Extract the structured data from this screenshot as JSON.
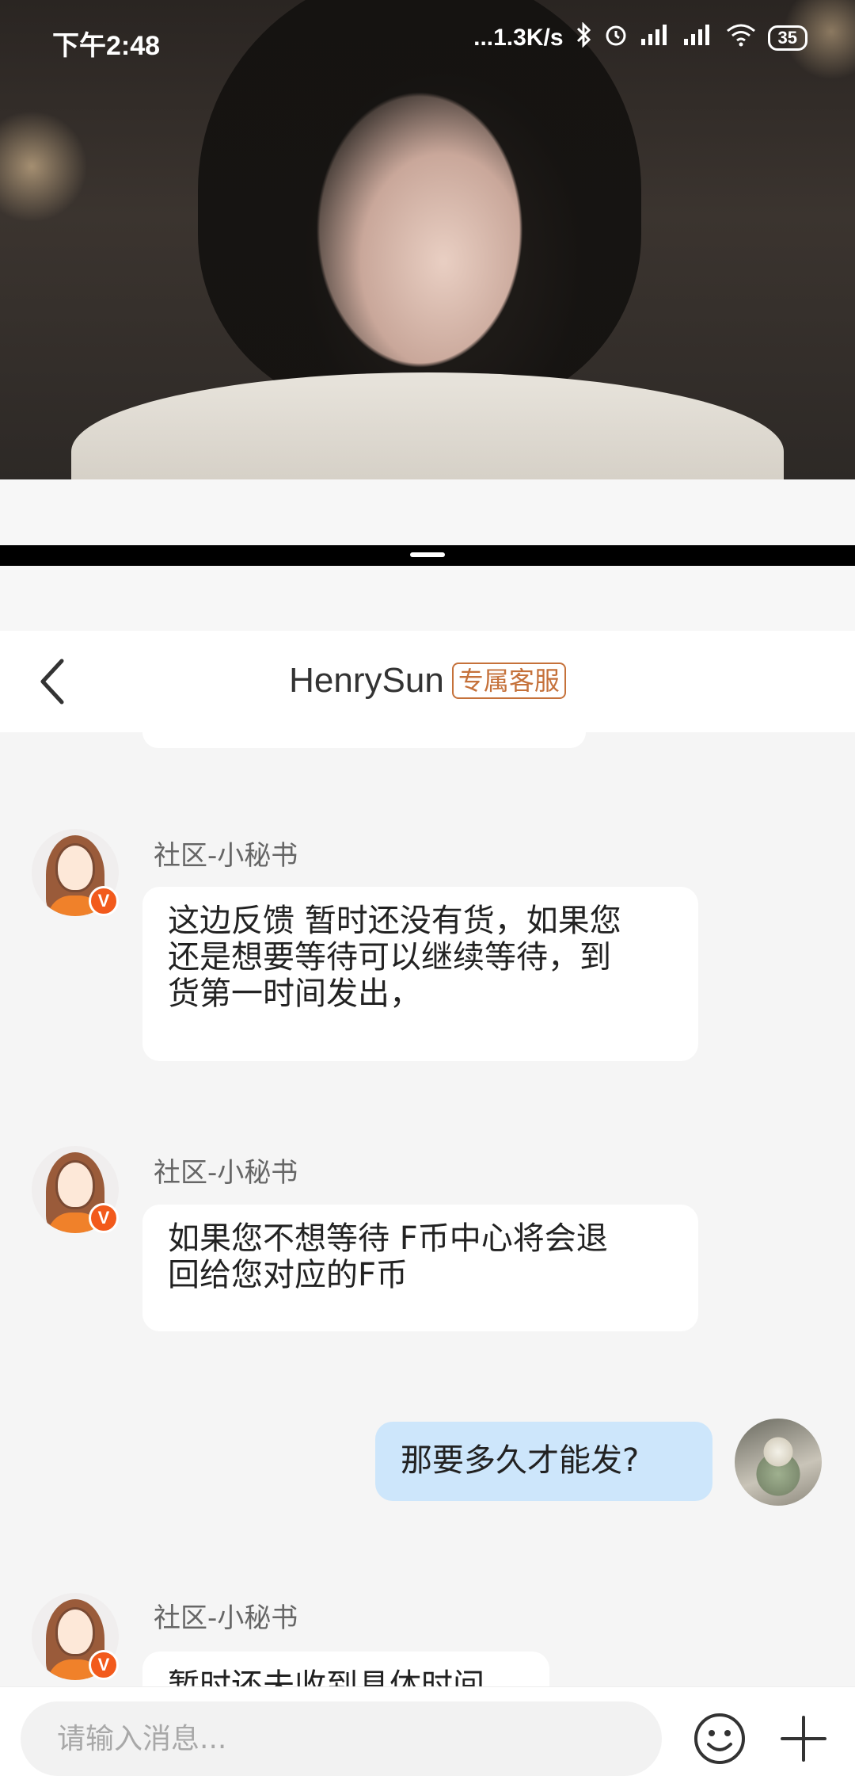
{
  "status_bar": {
    "time": "下午2:48",
    "network_speed": "...1.3K/s",
    "battery": "35"
  },
  "header": {
    "title": "HenrySun",
    "tag": "专属客服"
  },
  "messages": [
    {
      "sender": "社区-小秘书",
      "side": "left",
      "text_lines": [
        "这边反馈 暂时还没有货，如果您",
        "还是想要等待可以继续等待，到",
        "货第一时间发出，"
      ]
    },
    {
      "sender": "社区-小秘书",
      "side": "left",
      "text_lines": [
        "如果您不想等待 F币中心将会退",
        "回给您对应的F币"
      ]
    },
    {
      "side": "right",
      "text_lines": [
        "那要多久才能发?"
      ]
    },
    {
      "sender": "社区-小秘书",
      "side": "left",
      "text_lines": [
        "暂时还未收到具体时间"
      ]
    }
  ],
  "input": {
    "placeholder": "请输入消息..."
  },
  "icons": {
    "back": "chevron-left-icon",
    "emoji": "smiley-icon",
    "plus": "plus-icon",
    "badge": "v-badge"
  },
  "badge_letter": "V"
}
